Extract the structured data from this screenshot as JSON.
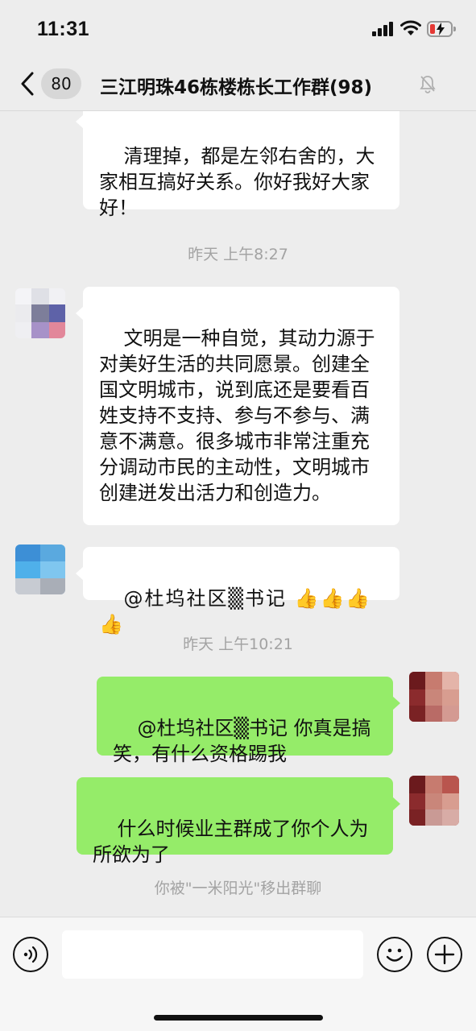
{
  "status_bar": {
    "time": "11:31"
  },
  "nav": {
    "unread_count": "80",
    "title": "三江明珠46栋楼栋长工作群(98)"
  },
  "messages": [
    {
      "type": "text",
      "side": "left",
      "text": "清理掉，都是左邻右舍的，大家相互搞好关系。你好我好大家好！"
    },
    {
      "type": "time",
      "text": "昨天 上午8:27"
    },
    {
      "type": "text",
      "side": "left",
      "text": "文明是一种自觉，其动力源于对美好生活的共同愿景。创建全国文明城市，说到底还是要看百姓支持不支持、参与不参与、满意不满意。很多城市非常注重充分调动市民的主动性，文明城市创建迸发出活力和创造力。"
    },
    {
      "type": "text",
      "side": "left",
      "text": "@杜坞社区▒书记 👍👍👍👍"
    },
    {
      "type": "time",
      "text": "昨天 上午10:21"
    },
    {
      "type": "text",
      "side": "right",
      "text": "@杜坞社区▒书记 你真是搞笑，有什么资格踢我"
    },
    {
      "type": "text",
      "side": "right",
      "text": "什么时候业主群成了你个人为所欲为了"
    },
    {
      "type": "system",
      "text": "你被\"一米阳光\"移出群聊"
    }
  ],
  "input": {
    "placeholder": ""
  },
  "colors": {
    "background": "#ededed",
    "bubble_self": "#95ec69",
    "bubble_other": "#ffffff",
    "timestamp": "#a3a3a3"
  },
  "icons": [
    "back-arrow-icon",
    "mute-bell-icon",
    "voice-icon",
    "emoji-icon",
    "plus-icon",
    "wifi-icon",
    "signal-icon",
    "battery-icon"
  ]
}
